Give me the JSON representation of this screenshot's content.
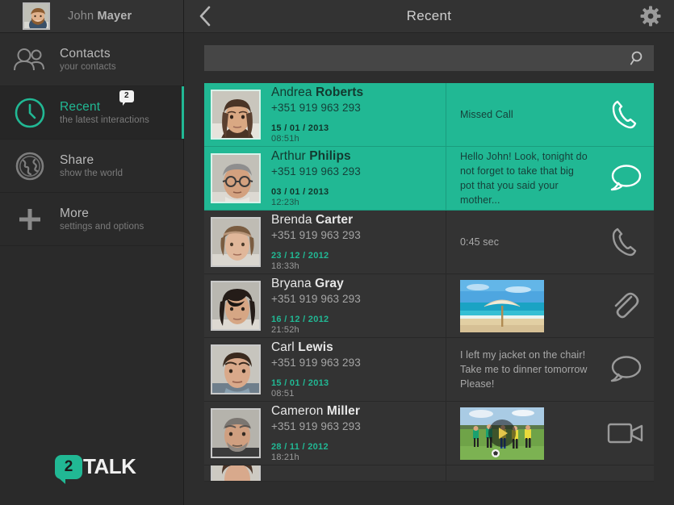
{
  "sidebar": {
    "user": {
      "name_first": "John",
      "name_last": "Mayer",
      "avatar": "user-photo"
    },
    "items": [
      {
        "label": "Contacts",
        "sub": "your contacts",
        "icon": "contacts-icon",
        "active": false,
        "badge": null
      },
      {
        "label": "Recent",
        "sub": "the latest interactions",
        "icon": "clock-icon",
        "active": true,
        "badge": "2"
      },
      {
        "label": "Share",
        "sub": "show the world",
        "icon": "globe-icon",
        "active": false,
        "badge": null
      },
      {
        "label": "More",
        "sub": "settings and options",
        "icon": "plus-icon",
        "active": false,
        "badge": null
      }
    ],
    "brand": {
      "mark": "2",
      "text": "TALK"
    }
  },
  "topbar": {
    "back": "back-chevron-icon",
    "title": "Recent",
    "settings": "gear-icon"
  },
  "search": {
    "value": "",
    "placeholder": "",
    "icon": "search-icon"
  },
  "list": [
    {
      "name_first": "Andrea",
      "name_last": "Roberts",
      "phone": "+351 919 963 293",
      "date": "15 / 01 / 2013",
      "time": "08:51h",
      "highlight": true,
      "message": "Missed Call",
      "media": null,
      "action_icon": "phone-icon"
    },
    {
      "name_first": "Arthur",
      "name_last": "Philips",
      "phone": "+351 919 963 293",
      "date": "03 / 01 / 2013",
      "time": "12:23h",
      "highlight": true,
      "message": "Hello John! Look, tonight do not forget to take that big pot that you said your mother...",
      "media": null,
      "action_icon": "chat-bubble-icon"
    },
    {
      "name_first": "Brenda",
      "name_last": "Carter",
      "phone": "+351 919 963 293",
      "date": "23 / 12 / 2012",
      "time": "18:33h",
      "highlight": false,
      "message": "0:45 sec",
      "media": null,
      "action_icon": "phone-icon"
    },
    {
      "name_first": "Bryana",
      "name_last": "Gray",
      "phone": "+351 919 963 293",
      "date": "16 / 12 / 2012",
      "time": "21:52h",
      "highlight": false,
      "message": "",
      "media": "beach-photo-thumbnail",
      "action_icon": "paperclip-icon"
    },
    {
      "name_first": "Carl",
      "name_last": "Lewis",
      "phone": "+351 919 963 293",
      "date": "15 / 01 / 2013",
      "time": "08:51",
      "highlight": false,
      "message": "I left my jacket on the chair! Take me to dinner tomorrow Please!",
      "media": null,
      "action_icon": "chat-bubble-icon"
    },
    {
      "name_first": "Cameron",
      "name_last": "Miller",
      "phone": "+351 919 963 293",
      "date": "28 / 11 / 2012",
      "time": "18:21h",
      "highlight": false,
      "message": "",
      "media": "soccer-video-thumbnail",
      "action_icon": "video-camera-icon"
    }
  ],
  "colors": {
    "accent": "#21b894",
    "row_bg": "#333333",
    "app_bg": "#2d2d2d",
    "sidebar_bg": "#2a2a2a",
    "search_bg": "#464646"
  }
}
